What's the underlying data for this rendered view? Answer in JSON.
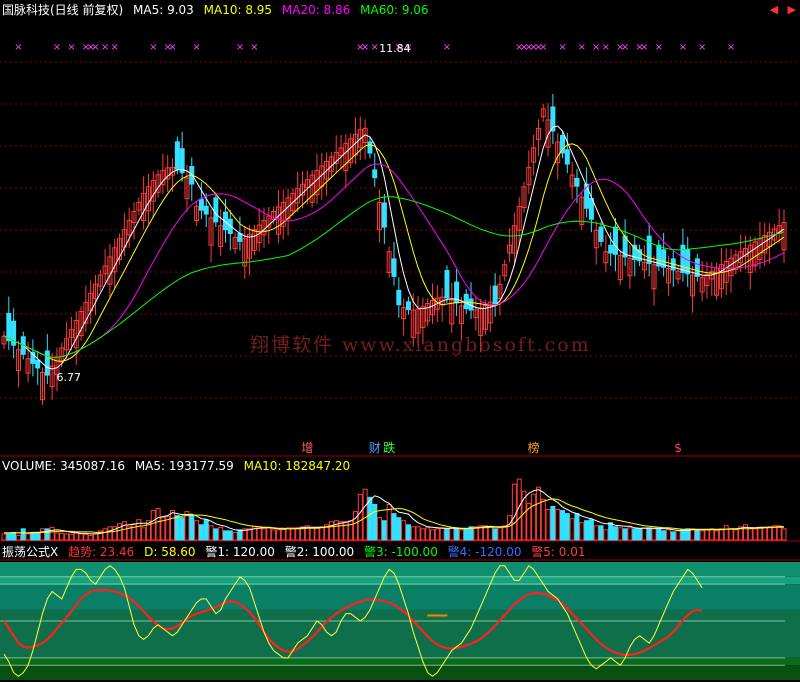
{
  "header": {
    "stock_name": "国脉科技(日线 前复权)",
    "ma_labels": [
      {
        "text": "MA5: 9.03",
        "color": "#ffffff"
      },
      {
        "text": "MA10: 8.95",
        "color": "#ffff00"
      },
      {
        "text": "MA20: 8.86",
        "color": "#ff00ff"
      },
      {
        "text": "MA60: 9.06",
        "color": "#00ff00"
      }
    ],
    "nav_icons": [
      "arrow-left-icon",
      "arrow-right-icon"
    ],
    "nav_glyphs": [
      "◀",
      "▶"
    ]
  },
  "watermark": "翔博软件  www.xiangbosoft.com",
  "volume_header": [
    {
      "text": "VOLUME: 345087.16",
      "color": "#ffffff"
    },
    {
      "text": "MA5: 193177.59",
      "color": "#ffffff"
    },
    {
      "text": "MA10: 182847.20",
      "color": "#ffff00"
    }
  ],
  "indicator_header": [
    {
      "text": "振荡公式X",
      "color": "#ffffff"
    },
    {
      "text": "趋势: 23.46",
      "color": "#ff3030"
    },
    {
      "text": "D: 58.60",
      "color": "#ffff00"
    },
    {
      "text": "警1: 120.00",
      "color": "#ffffff"
    },
    {
      "text": "警2: 100.00",
      "color": "#ffffff"
    },
    {
      "text": "警3: -100.00",
      "color": "#00ff00"
    },
    {
      "text": "警4: -120.00",
      "color": "#3b6bff"
    },
    {
      "text": "警5: 0.01",
      "color": "#ff4040"
    }
  ],
  "colors": {
    "up": "#ff3b3b",
    "down": "#33e0ff",
    "ma5": "#ffffff",
    "ma10": "#ffff00",
    "ma20": "#ff00ff",
    "ma60": "#00ff00",
    "grid": "#8a0000"
  },
  "chart_data": [
    {
      "type": "candlestick",
      "price_range": [
        5.8,
        12.3
      ],
      "grid": true,
      "annotations": [
        {
          "text": "11.84",
          "index": 75,
          "value": 11.84
        },
        {
          "text": "6.77",
          "index": 8,
          "value": 6.77
        }
      ],
      "event_labels": [
        {
          "text": "增",
          "index": 63,
          "color": "#ff6060"
        },
        {
          "text": "财",
          "index": 77,
          "color": "#40a0ff"
        },
        {
          "text": "跌",
          "index": 80,
          "color": "#40ff40"
        },
        {
          "text": "榜",
          "index": 110,
          "color": "#ffa020"
        },
        {
          "text": "$",
          "index": 140,
          "color": "#ff4040"
        }
      ],
      "signal_marks": [
        3,
        11,
        14,
        17,
        18,
        19,
        21,
        23,
        31,
        34,
        35,
        40,
        49,
        52,
        74,
        75,
        77,
        82,
        84,
        92,
        107,
        108,
        109,
        110,
        111,
        112,
        116,
        120,
        123,
        125,
        128,
        129,
        132,
        133,
        136,
        141,
        145,
        151
      ]
    },
    {
      "type": "bar",
      "name": "VOLUME",
      "values": [
        12,
        12,
        15,
        9,
        22,
        12,
        14,
        13,
        22,
        22,
        25,
        14,
        13,
        12,
        11,
        16,
        12,
        11,
        9,
        12,
        18,
        22,
        26,
        26,
        32,
        36,
        26,
        32,
        40,
        24,
        38,
        58,
        62,
        44,
        46,
        58,
        48,
        44,
        56,
        48,
        38,
        30,
        40,
        28,
        22,
        25,
        18,
        18,
        15,
        20,
        22,
        22,
        26,
        26,
        22,
        24,
        20,
        20,
        22,
        24,
        24,
        24,
        26,
        28,
        24,
        24,
        26,
        30,
        36,
        38,
        36,
        36,
        38,
        56,
        90,
        100,
        84,
        70,
        44,
        38,
        70,
        52,
        44,
        38,
        30,
        26,
        26,
        22,
        24,
        20,
        22,
        24,
        22,
        24,
        22,
        20,
        22,
        26,
        26,
        28,
        28,
        26,
        22,
        24,
        28,
        48,
        110,
        120,
        96,
        72,
        90,
        104,
        80,
        60,
        66,
        60,
        58,
        52,
        42,
        52,
        34,
        38,
        40,
        28,
        28,
        20,
        34,
        26,
        24,
        22,
        24,
        22,
        22,
        24,
        24,
        22,
        22,
        18,
        20,
        16,
        18,
        20,
        22,
        22,
        20,
        18,
        20,
        22,
        18,
        22,
        28,
        22,
        20,
        26,
        30,
        24,
        22,
        24,
        24,
        26,
        28,
        28,
        22
      ],
      "ma5": [
        14,
        14,
        14,
        14,
        14,
        14,
        15,
        15,
        16,
        17,
        19,
        20,
        19,
        17,
        15,
        14,
        13,
        13,
        12,
        12,
        13,
        15,
        18,
        21,
        25,
        29,
        30,
        31,
        33,
        33,
        33,
        38,
        44,
        46,
        48,
        54,
        52,
        50,
        50,
        51,
        47,
        42,
        41,
        37,
        32,
        29,
        27,
        23,
        20,
        19,
        19,
        20,
        22,
        23,
        24,
        24,
        23,
        22,
        21,
        22,
        22,
        23,
        24,
        25,
        25,
        25,
        25,
        26,
        28,
        31,
        33,
        35,
        37,
        43,
        54,
        67,
        78,
        87,
        84,
        77,
        72,
        62,
        55,
        53,
        51,
        41,
        34,
        30,
        26,
        25,
        24,
        23,
        23,
        23,
        23,
        22,
        22,
        23,
        24,
        25,
        26,
        27,
        26,
        26,
        26,
        31,
        46,
        66,
        82,
        92,
        97,
        99,
        94,
        86,
        80,
        74,
        65,
        60,
        55,
        52,
        47,
        44,
        42,
        38,
        34,
        32,
        32,
        29,
        28,
        27,
        27,
        24,
        23,
        23,
        23,
        23,
        23,
        22,
        22,
        20,
        19,
        19,
        19,
        20,
        20,
        20,
        20,
        20,
        20,
        20,
        21,
        22,
        22,
        23,
        25,
        24,
        24,
        25,
        25,
        25,
        25,
        26,
        26
      ],
      "ma10": [
        14,
        14,
        14,
        14,
        14,
        14,
        14,
        14,
        15,
        15,
        16,
        17,
        17,
        17,
        17,
        16,
        16,
        16,
        16,
        15,
        15,
        15,
        16,
        17,
        19,
        21,
        23,
        25,
        27,
        28,
        30,
        33,
        36,
        38,
        40,
        43,
        45,
        47,
        48,
        49,
        49,
        49,
        48,
        46,
        44,
        42,
        40,
        37,
        35,
        32,
        30,
        28,
        27,
        26,
        25,
        25,
        24,
        23,
        23,
        22,
        22,
        22,
        22,
        23,
        23,
        23,
        24,
        25,
        26,
        27,
        28,
        29,
        30,
        33,
        38,
        44,
        50,
        56,
        58,
        59,
        60,
        61,
        62,
        61,
        58,
        54,
        48,
        42,
        38,
        35,
        32,
        29,
        27,
        25,
        24,
        23,
        23,
        23,
        23,
        24,
        24,
        25,
        25,
        25,
        25,
        27,
        33,
        43,
        53,
        62,
        68,
        72,
        76,
        79,
        81,
        80,
        76,
        71,
        67,
        64,
        60,
        57,
        54,
        50,
        47,
        44,
        42,
        40,
        38,
        36,
        34,
        32,
        30,
        28,
        27,
        26,
        25,
        24,
        24,
        23,
        22,
        21,
        21,
        21,
        21,
        21,
        21,
        21,
        21,
        21,
        21,
        21,
        21,
        22,
        22,
        22,
        23,
        23,
        24,
        24,
        25,
        25,
        25
      ],
      "y_range": [
        0,
        130
      ]
    },
    {
      "type": "line",
      "name": "振荡公式X",
      "y_range": [
        -160,
        160
      ],
      "levels": [
        120,
        100,
        -100,
        -120,
        0.01
      ],
      "series": [
        {
          "name": "趋势",
          "color": "#ff2020",
          "values": [
            0,
            -20,
            -40,
            -60,
            -70,
            -72,
            -70,
            -66,
            -60,
            -50,
            -36,
            -20,
            -5,
            10,
            26,
            44,
            60,
            72,
            80,
            84,
            84,
            84,
            82,
            80,
            76,
            70,
            62,
            52,
            40,
            26,
            12,
            0,
            -12,
            -20,
            -22,
            -20,
            -14,
            -4,
            6,
            14,
            20,
            24,
            28,
            32,
            38,
            44,
            50,
            54,
            52,
            46,
            36,
            24,
            8,
            -10,
            -30,
            -48,
            -62,
            -72,
            -80,
            -84,
            -82,
            -76,
            -66,
            -56,
            -44,
            -30,
            -16,
            -2,
            10,
            20,
            28,
            36,
            42,
            48,
            52,
            56,
            58,
            58,
            56,
            54,
            50,
            44,
            36,
            26,
            14,
            0,
            -14,
            -28,
            -42,
            -54,
            -64,
            -70,
            -74,
            -74,
            -72,
            -70,
            -66,
            -62,
            -56,
            -48,
            -38,
            -26,
            -12,
            2,
            16,
            30,
            44,
            56,
            66,
            72,
            76,
            76,
            74,
            70,
            64,
            56,
            46,
            34,
            20,
            6,
            -8,
            -22,
            -36,
            -50,
            -62,
            -72,
            -80,
            -86,
            -90,
            -92,
            -92,
            -90,
            -86,
            -80,
            -74,
            -66,
            -58,
            -50,
            -42,
            -30,
            -14,
            2,
            16,
            26,
            30,
            28
          ]
        },
        {
          "name": "D",
          "color": "#ffff40",
          "values": [
            -90,
            -110,
            -140,
            -150,
            -140,
            -120,
            -80,
            -30,
            20,
            60,
            80,
            70,
            60,
            90,
            120,
            140,
            140,
            130,
            110,
            100,
            120,
            140,
            150,
            140,
            120,
            90,
            40,
            -10,
            -40,
            -50,
            -40,
            -20,
            -10,
            -20,
            -30,
            -40,
            -30,
            -10,
            10,
            30,
            50,
            60,
            60,
            40,
            20,
            30,
            60,
            80,
            100,
            120,
            110,
            90,
            50,
            10,
            -30,
            -60,
            -80,
            -90,
            -100,
            -100,
            -80,
            -60,
            -50,
            -40,
            -20,
            0,
            -10,
            -30,
            -40,
            -30,
            0,
            20,
            20,
            10,
            0,
            10,
            30,
            60,
            90,
            120,
            140,
            130,
            100,
            60,
            20,
            -30,
            -70,
            -110,
            -140,
            -150,
            -140,
            -120,
            -100,
            -80,
            -70,
            -60,
            -40,
            -20,
            10,
            40,
            70,
            100,
            130,
            150,
            150,
            130,
            110,
            110,
            130,
            150,
            140,
            120,
            100,
            80,
            70,
            60,
            40,
            20,
            -10,
            -40,
            -70,
            -100,
            -120,
            -130,
            -120,
            -110,
            -100,
            -110,
            -120,
            -100,
            -70,
            -50,
            -40,
            -50,
            -60,
            -40,
            -10,
            20,
            50,
            80,
            100,
            120,
            140,
            130,
            110,
            90
          ]
        }
      ],
      "markers": [
        {
          "label": "警5",
          "index": 90,
          "value": 15,
          "color": "#ff8000"
        }
      ]
    }
  ]
}
